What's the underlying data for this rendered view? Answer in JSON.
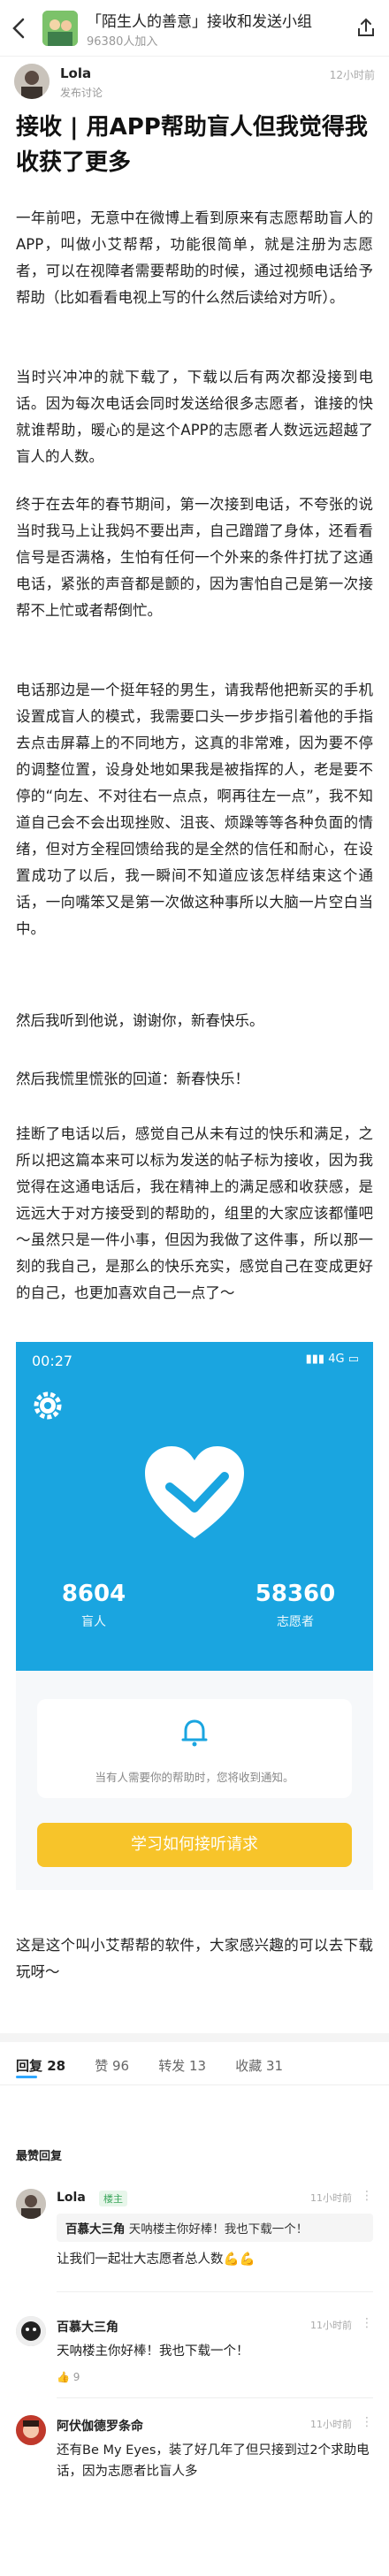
{
  "topbar": {
    "group_name": "「陌生人的善意」接收和发送小组",
    "group_members": "96380人加入"
  },
  "author": {
    "name": "Lola",
    "subtitle": "发布讨论",
    "time": "12小时前"
  },
  "post": {
    "title": "接收 | 用APP帮助盲人但我觉得我收获了更多",
    "paragraphs": [
      "一年前吧，无意中在微博上看到原来有志愿帮助盲人的APP，叫做小艾帮帮，功能很简单，就是注册为志愿者，可以在视障者需要帮助的时候，通过视频电话给予帮助（比如看看电视上写的什么然后读给对方听）。",
      "当时兴冲冲的就下载了，下载以后有两次都没接到电话。因为每次电话会同时发送给很多志愿者，谁接的快就谁帮助，暖心的是这个APP的志愿者人数远远超越了盲人的人数。",
      "终于在去年的春节期间，第一次接到电话，不夸张的说当时我马上让我妈不要出声，自己蹭蹭了身体，还看看信号是否满格，生怕有任何一个外来的条件打扰了这通电话，紧张的声音都是颤的，因为害怕自己是第一次接帮不上忙或者帮倒忙。",
      "电话那边是一个挺年轻的男生，请我帮他把新买的手机设置成盲人的模式，我需要口头一步步指引着他的手指去点击屏幕上的不同地方，这真的非常难，因为要不停的调整位置，设身处地如果我是被指挥的人，老是要不停的“向左、不对往右一点点，啊再往左一点”，我不知道自己会不会出现挫败、沮丧、烦躁等等各种负面的情绪，但对方全程回馈给我的是全然的信任和耐心，在设置成功了以后，我一瞬间不知道应该怎样结束这个通话，一向嘴笨又是第一次做这种事所以大脑一片空白当中。",
      "然后我听到他说，谢谢你，新春快乐。",
      "然后我慌里慌张的回道：新春快乐！",
      "挂断了电话以后，感觉自己从未有过的快乐和满足，之所以把这篇本来可以标为发送的帖子标为接收，因为我觉得在这通电话后，我在精神上的满足感和收获感，是远远大于对方接受到的帮助的，组里的大家应该都懂吧～虽然只是一件小事，但因为我做了这件事，所以那一刻的我自己，是那么的快乐充实，感觉自己在变成更好的自己，也更加喜欢自己一点了～",
      "这是这个叫小艾帮帮的软件，大家感兴趣的可以去下载玩呀～"
    ]
  },
  "app_screenshot": {
    "clock": "00:27",
    "network": "4G",
    "blind_count": "8604",
    "blind_label": "盲人",
    "volunteer_count": "58360",
    "volunteer_label": "志愿者",
    "notice_text": "当有人需要你的帮助时，您将收到通知。",
    "learn_button": "学习如何接听请求",
    "colors": {
      "primary": "#1aa5e0",
      "button": "#f7c42a"
    }
  },
  "tabs": [
    {
      "label": "回复",
      "count": "28"
    },
    {
      "label": "赞",
      "count": "96"
    },
    {
      "label": "转发",
      "count": "13"
    },
    {
      "label": "收藏",
      "count": "31"
    }
  ],
  "sort_label": "最赞回复",
  "comments": [
    {
      "name": "Lola",
      "badge": "楼主",
      "time": "11小时前",
      "quote_author": "百慕大三角",
      "quote_text": "天呐楼主你好棒！我也下载一个！",
      "text": "让我们一起壮大志愿者总人数💪💪",
      "likes": ""
    },
    {
      "name": "百慕大三角",
      "badge": "",
      "time": "11小时前",
      "text": "天呐楼主你好棒！我也下载一个！",
      "likes": "9"
    },
    {
      "name": "阿伏伽德罗条命",
      "badge": "",
      "time": "11小时前",
      "text": "还有Be My Eyes，装了好几年了但只接到过2个求助电话，因为志愿者比盲人多",
      "likes": ""
    }
  ]
}
